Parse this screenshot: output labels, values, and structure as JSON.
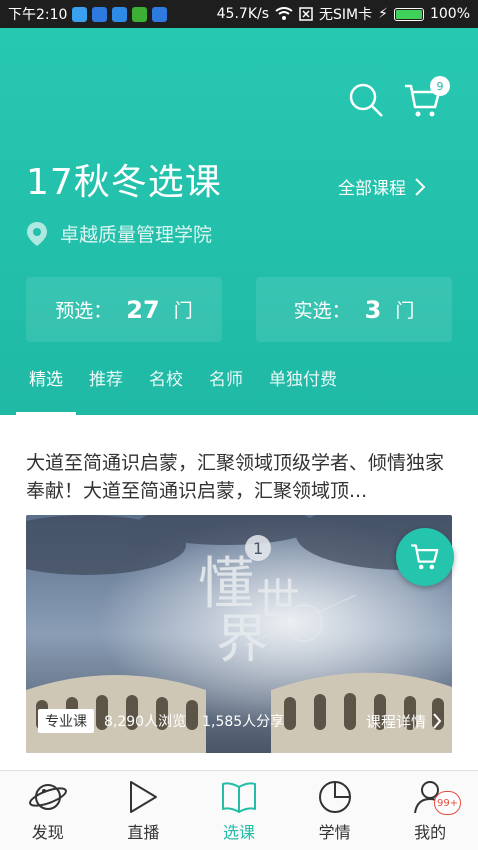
{
  "status_bar": {
    "time": "下午2:10",
    "speed": "45.7K/s",
    "sim": "无SIM卡",
    "battery": "100%",
    "battery_level": 1.0
  },
  "header": {
    "cart_count": "9",
    "title": "17秋冬选课",
    "all_courses": "全部课程",
    "location": "卓越质量管理学院",
    "preselect": {
      "label": "预选：",
      "value": "27",
      "unit": "门"
    },
    "actual": {
      "label": "实选：",
      "value": "3",
      "unit": "门"
    },
    "tabs": [
      {
        "label": "精选"
      },
      {
        "label": "推荐"
      },
      {
        "label": "名校"
      },
      {
        "label": "名师"
      },
      {
        "label": "单独付费"
      }
    ]
  },
  "course": {
    "description": "大道至简通识启蒙，汇聚领域顶级学者、倾情独家奉献！大道至简通识启蒙，汇聚领域顶...",
    "banner": {
      "art_title_1": "懂",
      "art_title_2": "世",
      "art_title_3": "界",
      "art_number": "1"
    },
    "tag": "专业课",
    "views": "8,290人浏览",
    "shares": "1,585人分享",
    "detail": "课程详情"
  },
  "bottom_nav": [
    {
      "label": "发现"
    },
    {
      "label": "直播"
    },
    {
      "label": "选课"
    },
    {
      "label": "学情"
    },
    {
      "label": "我的",
      "badge": "99+"
    }
  ],
  "colors": {
    "accent": "#1fb9a5",
    "active_nav": "#23bca7",
    "badge": "#e74c3c"
  }
}
